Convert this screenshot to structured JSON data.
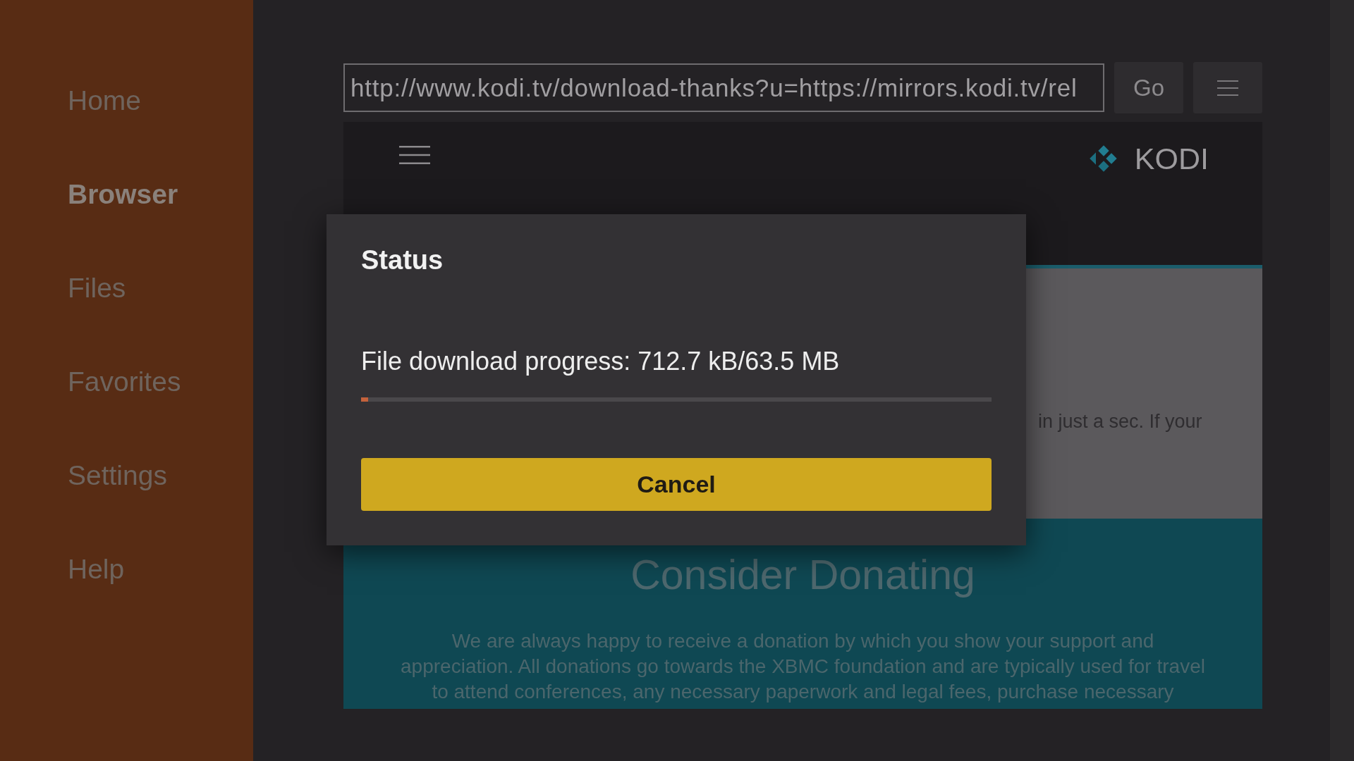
{
  "sidebar": {
    "items": [
      {
        "label": "Home",
        "selected": false
      },
      {
        "label": "Browser",
        "selected": true
      },
      {
        "label": "Files",
        "selected": false
      },
      {
        "label": "Favorites",
        "selected": false
      },
      {
        "label": "Settings",
        "selected": false
      },
      {
        "label": "Help",
        "selected": false
      }
    ]
  },
  "address_bar": {
    "url": "http://www.kodi.tv/download-thanks?u=https://mirrors.kodi.tv/rel",
    "go_button": "Go"
  },
  "web_page": {
    "header": {
      "logo_text": "KODI"
    },
    "notice_fragment": "in just a sec. If your",
    "donate_section": {
      "title": "Consider Donating",
      "paragraph_lines": [
        "We are always happy to receive a donation by which you show your support and",
        "appreciation. All donations go towards the XBMC foundation and are typically used for travel",
        "to attend conferences, any necessary paperwork and legal fees, purchase necessary"
      ]
    }
  },
  "dialog": {
    "title": "Status",
    "message": "File download progress: 712.7 kB/63.5 MB",
    "progress": {
      "level": 0.011
    },
    "cancel_button": "Cancel"
  }
}
